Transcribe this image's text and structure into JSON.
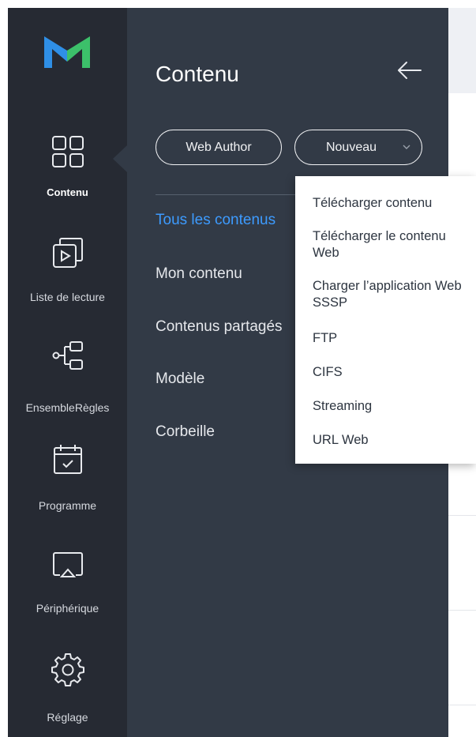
{
  "sidebar": {
    "items": [
      {
        "label": "Contenu",
        "icon": "grid-icon",
        "active": true
      },
      {
        "label": "Liste de lecture",
        "icon": "playlist-icon"
      },
      {
        "label": "EnsembleRègles",
        "icon": "ruleset-icon"
      },
      {
        "label": "Programme",
        "icon": "calendar-icon"
      },
      {
        "label": "Périphérique",
        "icon": "display-icon"
      },
      {
        "label": "Réglage",
        "icon": "gear-icon"
      }
    ]
  },
  "panel": {
    "title": "Contenu",
    "web_author_label": "Web Author",
    "new_label": "Nouveau",
    "menu": [
      {
        "label": "Tous les contenus",
        "active": true
      },
      {
        "label": "Mon contenu"
      },
      {
        "label": "Contenus partagés"
      },
      {
        "label": "Modèle"
      },
      {
        "label": "Corbeille"
      }
    ]
  },
  "dropdown": {
    "items": [
      "Télécharger contenu",
      "Télécharger le contenu Web",
      "Charger l’application Web SSSP",
      "FTP",
      "CIFS",
      "Streaming",
      "URL Web"
    ]
  },
  "colors": {
    "rail_bg": "#262a33",
    "panel_bg": "#323a46",
    "accent": "#3d9bff",
    "logo_blue": "#2f8fe6",
    "logo_green": "#3cc06a"
  }
}
